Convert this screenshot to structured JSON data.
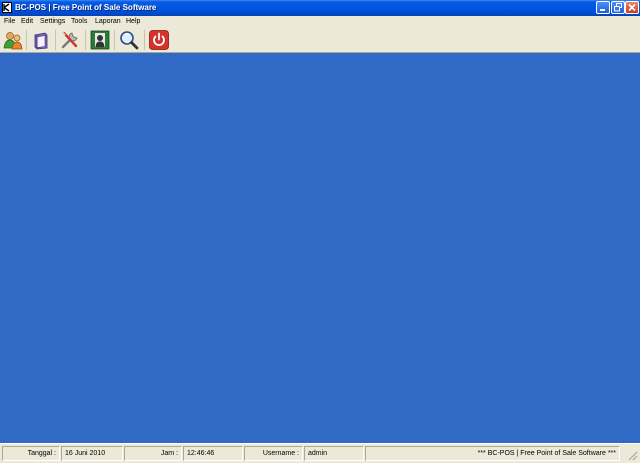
{
  "window": {
    "title": "BC-POS  |  Free Point of Sale Software",
    "icon": "bc-pos-app-icon",
    "controls": [
      "minimize-icon",
      "maximize-icon",
      "close-icon"
    ]
  },
  "menu": {
    "items": [
      "File",
      "Edit",
      "Settings",
      "Tools",
      "Laporan",
      "Help"
    ]
  },
  "toolbar": {
    "buttons": [
      {
        "icon": "users-icon"
      },
      {
        "icon": "product-box-icon"
      },
      {
        "icon": "tools-icon"
      },
      {
        "icon": "report-icon"
      },
      {
        "icon": "search-magnifier-icon"
      },
      {
        "icon": "power-exit-icon"
      }
    ]
  },
  "main": {
    "background": "#3169C6"
  },
  "status": {
    "date_label": "Tanggal :",
    "date_value": "16 Juni 2010",
    "time_label": "Jam :",
    "time_value": "12:46:46",
    "user_label": "Username :",
    "user_value": "admin",
    "footer_text": "*** BC-POS | Free Point of Sale Software ***"
  },
  "colors": {
    "titlebar": "#0055E5",
    "desktop": "#3169C6",
    "chrome": "#ECE9D8",
    "close_button": "#C8401E"
  }
}
